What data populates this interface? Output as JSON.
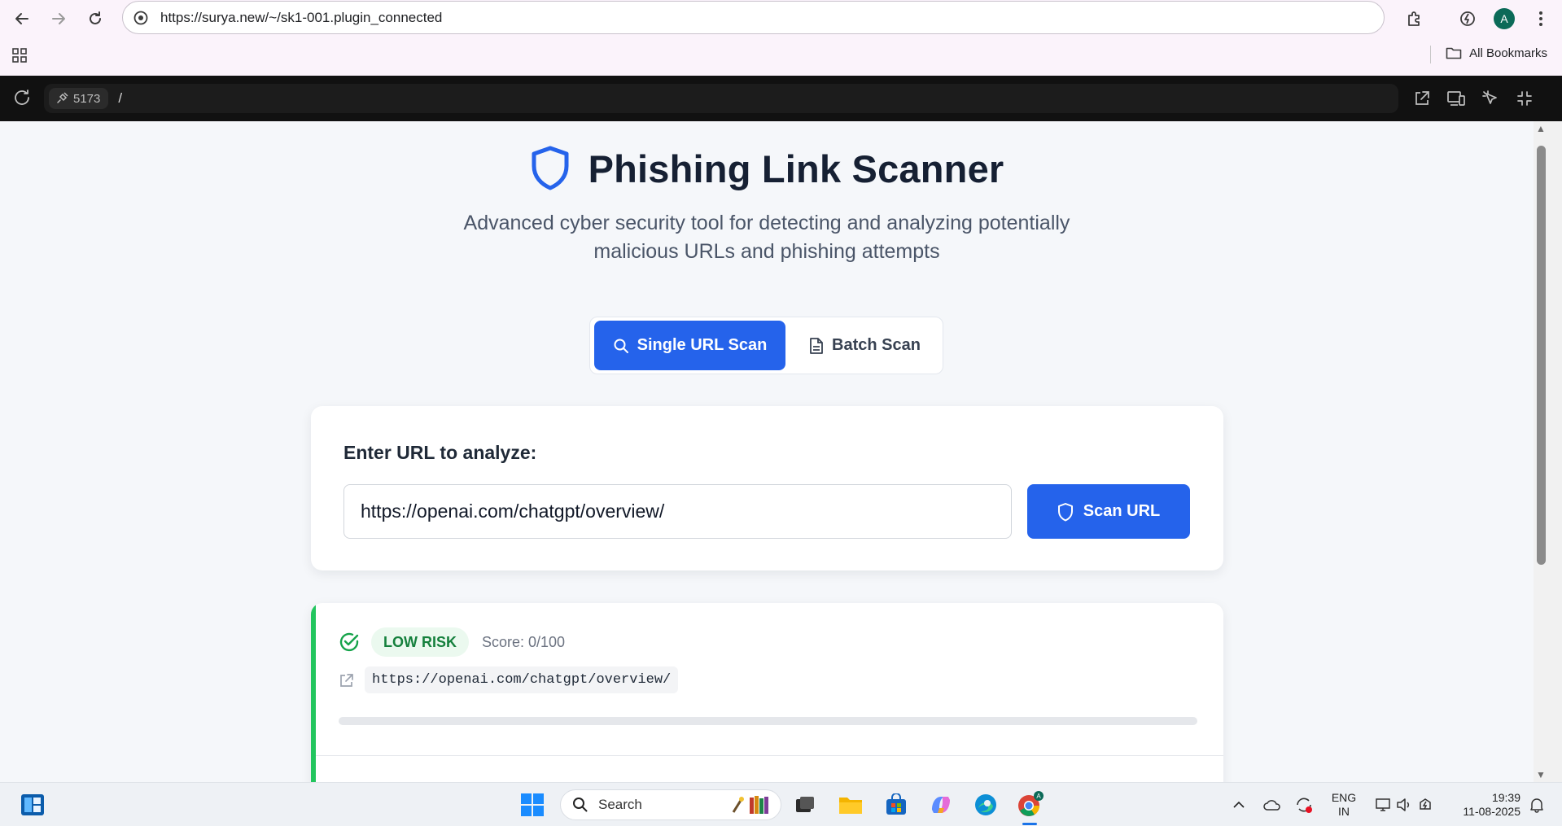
{
  "browser": {
    "url": "https://surya.new/~/sk1-001.plugin_connected",
    "profile_initial": "A",
    "bookmarks_label": "All Bookmarks"
  },
  "devbar": {
    "port": "5173",
    "path": "/"
  },
  "header": {
    "title": "Phishing Link Scanner",
    "subtitle_line1": "Advanced cyber security tool for detecting and analyzing potentially",
    "subtitle_line2": "malicious URLs and phishing attempts"
  },
  "tabs": [
    {
      "label": "Single URL Scan",
      "icon": "search-icon",
      "active": true
    },
    {
      "label": "Batch Scan",
      "icon": "document-icon",
      "active": false
    }
  ],
  "scan_form": {
    "label": "Enter URL to analyze:",
    "input_value": "https://openai.com/chatgpt/overview/",
    "button_label": "Scan URL"
  },
  "result": {
    "risk_level": "LOW RISK",
    "score_text": "Score: 0/100",
    "score": 0,
    "scanned_url": "https://openai.com/chatgpt/overview/",
    "status_icon": "check-circle-icon"
  },
  "taskbar": {
    "search_placeholder": "Search",
    "language_line1": "ENG",
    "language_line2": "IN",
    "time": "19:39",
    "date": "11-08-2025"
  },
  "colors": {
    "primary": "#2563eb",
    "low_risk": "#22c55e",
    "low_risk_text": "#15803d",
    "title": "#162033"
  }
}
